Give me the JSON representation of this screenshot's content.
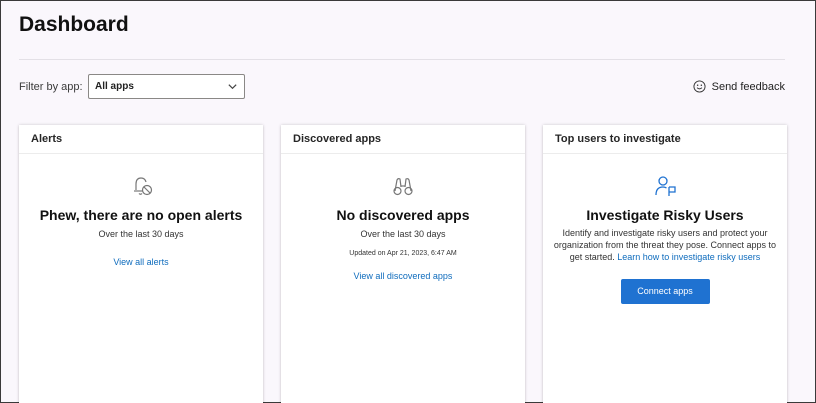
{
  "page": {
    "title": "Dashboard",
    "filter_label": "Filter by app:",
    "filter_value": "All apps",
    "feedback_label": "Send feedback"
  },
  "cards": {
    "alerts": {
      "header": "Alerts",
      "icon": "bell-off-icon",
      "heading": "Phew, there are no open alerts",
      "subtitle": "Over the last 30 days",
      "link": "View all alerts"
    },
    "discovered": {
      "header": "Discovered apps",
      "icon": "binoculars-icon",
      "heading": "No discovered apps",
      "subtitle": "Over the last 30 days",
      "updated": "Updated on Apr 21, 2023, 6:47 AM",
      "link": "View all discovered apps"
    },
    "risky": {
      "header": "Top users to investigate",
      "icon": "user-flag-icon",
      "heading": "Investigate Risky Users",
      "description": "Identify and investigate risky users and protect your organization from the threat they pose. Connect apps to get started.",
      "link": "Learn how to investigate risky users",
      "button": "Connect apps"
    }
  },
  "colors": {
    "accent": "#1f72d1",
    "link": "#0f6cbd",
    "background": "#faf7fc"
  }
}
